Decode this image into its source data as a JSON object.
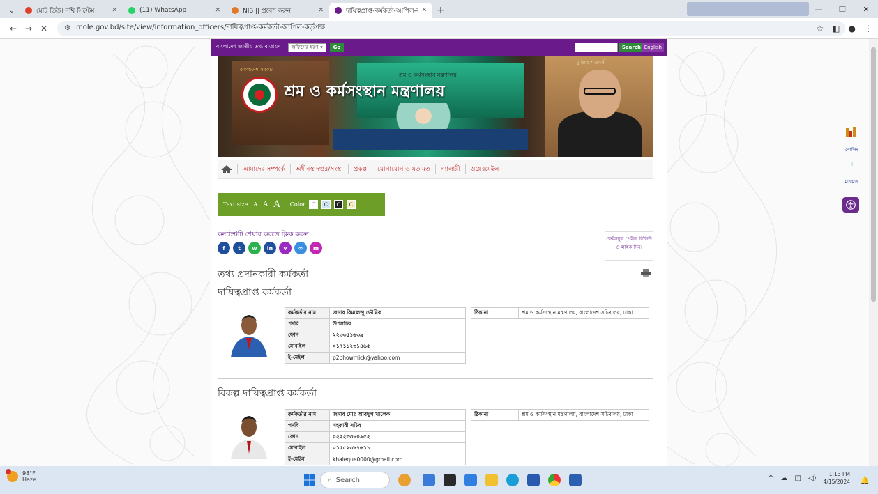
{
  "browser": {
    "tabs": [
      {
        "title": "মোট তিউ। নথি সিস্টেম",
        "favicon_color": "#e0402a"
      },
      {
        "title": "(11) WhatsApp",
        "favicon_color": "#25d366"
      },
      {
        "title": "NIS || প্রবেশ করুন",
        "favicon_color": "#e07a2a"
      },
      {
        "title": "দায়িত্বপ্রাপ্ত-কর্মকর্তা-আপিল-ক",
        "favicon_color": "#6a1a8a"
      }
    ],
    "new_tab": "+",
    "url": "mole.gov.bd/site/view/information_officers/দায়িত্বপ্রাপ্ত-কর্মকর্তা-আপিল-কর্তৃপক্ষ"
  },
  "site": {
    "portal_label": "বাংলাদেশ জাতীয় তথ্য বাতায়ন",
    "office_select": "অফিসের ধরণ",
    "go_label": "Go",
    "search_label": "Search",
    "english_label": "English",
    "banner": {
      "title": "শ্রম ও কর্মসংস্থান মন্ত্রণালয়",
      "stage_text": "শ্রম ও কর্মসংস্থান মন্ত্রণালয়",
      "sub_text": "বাংলাদেশ সরকার",
      "portrait_label": "মুজিব শতবর্ষ"
    },
    "nav": [
      {
        "label": "আমাদের সম্পর্কে"
      },
      {
        "label": "অধীনস্থ দপ্তর/সংস্থা"
      },
      {
        "label": "প্রকল্প"
      },
      {
        "label": "যোগাযোগ ও মতামত"
      },
      {
        "label": "গ্যালারী"
      },
      {
        "label": "ওয়েবমেইল"
      }
    ],
    "accessibility": {
      "text_size_label": "Text size",
      "a_small": "A",
      "a_medium": "A",
      "a_large": "A",
      "color_label": "Color",
      "color_opts": [
        "C",
        "C",
        "C",
        "C"
      ]
    },
    "share": {
      "label": "কনটেন্টটি শেয়ার করতে ক্লিক করুন"
    },
    "facebook_box": "ফেইসবুক পেইজ রিভিউ ও লাইক দিন।",
    "heading": "তথ্য প্রদানকারী কর্মকর্তা",
    "officer_heading": "দায়িত্বপ্রাপ্ত কর্মকর্তা",
    "alt_heading": "বিকল্প দায়িত্বপ্রাপ্ত কর্মকর্তা",
    "officer": {
      "name_key": "কর্মকর্তার নাম",
      "name": "জনাব বিমলেন্দু ভৌমিক",
      "desig_key": "পদবি",
      "desig": "উপসচিব",
      "phone_key": "ফোন",
      "phone": "২২৩৩৫১৬৩৯",
      "mobile_key": "মোবাইল",
      "mobile": "০১৭১১২৩১৪৬৫",
      "email_key": "ই-মেইল",
      "email": "p2bhowmick@yahoo.com",
      "addr_key": "ঠিকানা",
      "addr": "শ্রম ও কর্মসংস্থান মন্ত্রণালয়, বাংলাদেশ সচিবালয়, ঢাকা"
    },
    "alt_officer": {
      "name_key": "কর্মকর্তার নাম",
      "name": "জনাব মোঃ আবদুল খালেক",
      "desig_key": "পদবি",
      "desig": "সহকারী সচিব",
      "phone_key": "ফোন",
      "phone": "০২২২৩৩৮০৯৫২",
      "mobile_key": "মোবাইল",
      "mobile": "০১৫৫২৩৮৭৬১১",
      "email_key": "ই-মেইল",
      "email": "khaleque0000@gmail.com",
      "addr_key": "ঠিকানা",
      "addr": "শ্রম ও কর্মসংস্থান মন্ত্রণালয়, বাংলাদেশ সচিবালয়, ঢাকা"
    },
    "right_sidebar": {
      "poll_label": "পোলিং",
      "feedback_label": "মতামত"
    }
  },
  "taskbar": {
    "weather_temp": "98°F",
    "weather_desc": "Haze",
    "search_placeholder": "Search",
    "time": "1:13 PM",
    "date": "4/15/2024"
  }
}
